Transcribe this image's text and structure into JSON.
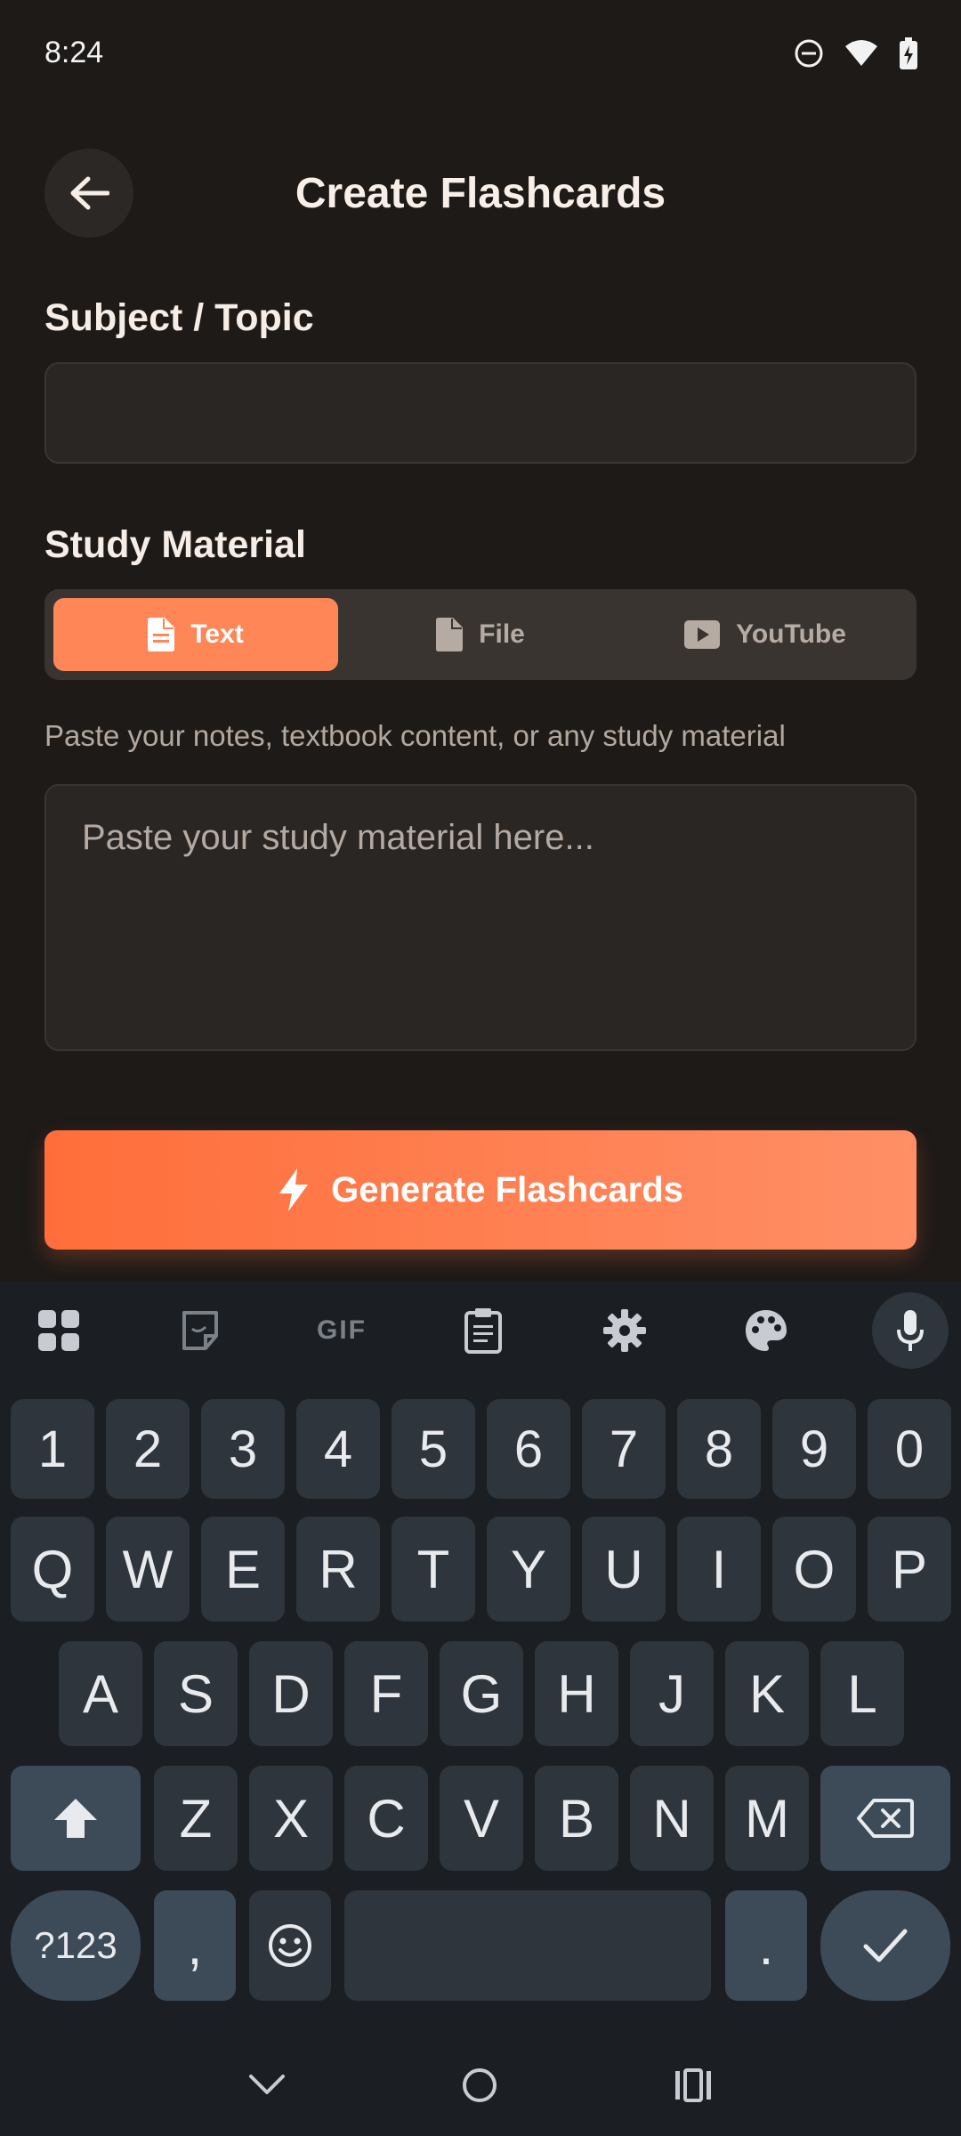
{
  "status_bar": {
    "time": "8:24"
  },
  "header": {
    "title": "Create Flashcards"
  },
  "subject": {
    "label": "Subject / Topic",
    "value": ""
  },
  "study_material": {
    "label": "Study Material",
    "tabs": [
      {
        "label": "Text",
        "icon": "document-icon",
        "active": true
      },
      {
        "label": "File",
        "icon": "file-icon",
        "active": false
      },
      {
        "label": "YouTube",
        "icon": "youtube-icon",
        "active": false
      }
    ],
    "hint": "Paste your notes, textbook content, or any study material",
    "placeholder": "Paste your study material here..."
  },
  "generate_button": {
    "label": "Generate Flashcards"
  },
  "keyboard": {
    "toolbar": [
      "apps-icon",
      "sticker-icon",
      "gif-icon",
      "clipboard-icon",
      "settings-icon",
      "palette-icon",
      "mic-icon"
    ],
    "gif_label": "GIF",
    "number_row": [
      "1",
      "2",
      "3",
      "4",
      "5",
      "6",
      "7",
      "8",
      "9",
      "0"
    ],
    "row1": [
      "Q",
      "W",
      "E",
      "R",
      "T",
      "Y",
      "U",
      "I",
      "O",
      "P"
    ],
    "row2": [
      "A",
      "S",
      "D",
      "F",
      "G",
      "H",
      "J",
      "K",
      "L"
    ],
    "row3": [
      "Z",
      "X",
      "C",
      "V",
      "B",
      "N",
      "M"
    ],
    "symbols_label": "?123",
    "comma": ",",
    "period": "."
  },
  "colors": {
    "accent": "#ff8656",
    "background": "#1d1a18",
    "keyboard": "#1b1f24"
  }
}
